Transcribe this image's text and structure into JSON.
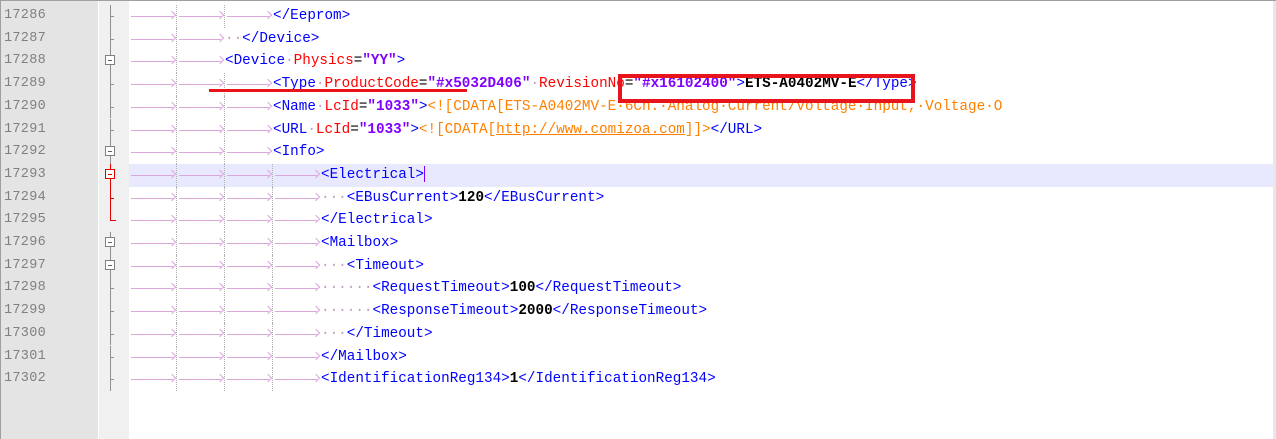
{
  "editor": {
    "current_line": "17293",
    "lines": [
      {
        "n": "17286",
        "indent": 3,
        "fold": "line",
        "tokens": [
          [
            "tag",
            "</Eeprom>"
          ]
        ]
      },
      {
        "n": "17287",
        "indent": 2,
        "fold": "line",
        "lead": "··",
        "tokens": [
          [
            "tag",
            "</Device>"
          ]
        ]
      },
      {
        "n": "17288",
        "indent": 2,
        "fold": "open",
        "tokens": [
          [
            "tag",
            "<Device"
          ],
          [
            "ws",
            "·"
          ],
          [
            "attr",
            "Physics"
          ],
          [
            "eq",
            "="
          ],
          [
            "val",
            "\"YY\""
          ],
          [
            "tag",
            ">"
          ]
        ]
      },
      {
        "n": "17289",
        "indent": 3,
        "fold": "line",
        "tokens": [
          [
            "tag",
            "<Type"
          ],
          [
            "ws",
            "·"
          ],
          [
            "attr",
            "ProductCode"
          ],
          [
            "eq",
            "="
          ],
          [
            "val",
            "\"#x5032D406\""
          ],
          [
            "ws",
            "·"
          ],
          [
            "attr",
            "RevisionNo"
          ],
          [
            "eq",
            "="
          ],
          [
            "val",
            "\"#x16102400\""
          ],
          [
            "tag",
            ">"
          ],
          [
            "text",
            "ETS-A0402MV-E"
          ],
          [
            "tag",
            "</Type>"
          ]
        ]
      },
      {
        "n": "17290",
        "indent": 3,
        "fold": "line",
        "tokens": [
          [
            "tag",
            "<Name"
          ],
          [
            "ws",
            "·"
          ],
          [
            "attr",
            "LcId"
          ],
          [
            "eq",
            "="
          ],
          [
            "val",
            "\"1033\""
          ],
          [
            "tag",
            ">"
          ],
          [
            "cdata",
            "<![CDATA[ETS-A0402MV-E·6Ch.·Analog·Current/Voltage·Input,·Voltage·O"
          ]
        ]
      },
      {
        "n": "17291",
        "indent": 3,
        "fold": "line",
        "tokens": [
          [
            "tag",
            "<URL"
          ],
          [
            "ws",
            "·"
          ],
          [
            "attr",
            "LcId"
          ],
          [
            "eq",
            "="
          ],
          [
            "val",
            "\"1033\""
          ],
          [
            "tag",
            ">"
          ],
          [
            "cdata",
            "<![CDATA["
          ],
          [
            "cdata-link",
            "http://www.comizoa.com"
          ],
          [
            "cdata",
            "]]>"
          ],
          [
            "tag",
            "</URL>"
          ]
        ]
      },
      {
        "n": "17292",
        "indent": 3,
        "fold": "open",
        "tokens": [
          [
            "tag",
            "<Info>"
          ]
        ]
      },
      {
        "n": "17293",
        "indent": 4,
        "fold": "open-red",
        "caret": true,
        "tokens": [
          [
            "tag",
            "<Electrical>"
          ]
        ]
      },
      {
        "n": "17294",
        "indent": 4,
        "fold": "line-red",
        "lead": "···",
        "tokens": [
          [
            "tag",
            "<EBusCurrent>"
          ],
          [
            "text",
            "120"
          ],
          [
            "tag",
            "</EBusCurrent>"
          ]
        ]
      },
      {
        "n": "17295",
        "indent": 4,
        "fold": "end-red",
        "tokens": [
          [
            "tag",
            "</Electrical>"
          ]
        ]
      },
      {
        "n": "17296",
        "indent": 4,
        "fold": "open",
        "tokens": [
          [
            "tag",
            "<Mailbox>"
          ]
        ]
      },
      {
        "n": "17297",
        "indent": 4,
        "fold": "open",
        "lead": "···",
        "tokens": [
          [
            "tag",
            "<Timeout>"
          ]
        ]
      },
      {
        "n": "17298",
        "indent": 4,
        "fold": "line",
        "lead": "······",
        "tokens": [
          [
            "tag",
            "<RequestTimeout>"
          ],
          [
            "text",
            "100"
          ],
          [
            "tag",
            "</RequestTimeout>"
          ]
        ]
      },
      {
        "n": "17299",
        "indent": 4,
        "fold": "line",
        "lead": "······",
        "tokens": [
          [
            "tag",
            "<ResponseTimeout>"
          ],
          [
            "text",
            "2000"
          ],
          [
            "tag",
            "</ResponseTimeout>"
          ]
        ]
      },
      {
        "n": "17300",
        "indent": 4,
        "fold": "line",
        "lead": "···",
        "tokens": [
          [
            "tag",
            "</Timeout>"
          ]
        ]
      },
      {
        "n": "17301",
        "indent": 4,
        "fold": "line",
        "tokens": [
          [
            "tag",
            "</Mailbox>"
          ]
        ]
      },
      {
        "n": "17302",
        "indent": 4,
        "fold": "line",
        "tokens": [
          [
            "tag",
            "<IdentificationReg134>"
          ],
          [
            "text",
            "1"
          ],
          [
            "tag",
            "</IdentificationReg134>"
          ]
        ]
      }
    ]
  },
  "annotations": {
    "box_color": "#e8141c",
    "highlight_target": "RevisionNo=\"#x16102400\"",
    "underline_target": "<Device Physics=\"YY\">"
  },
  "colors": {
    "tag": "#0000ff",
    "attribute": "#ff0000",
    "value": "#8000ff",
    "cdata": "#ff8000",
    "gutter": "#e4e4e4",
    "current_line": "#e8e8ff"
  }
}
